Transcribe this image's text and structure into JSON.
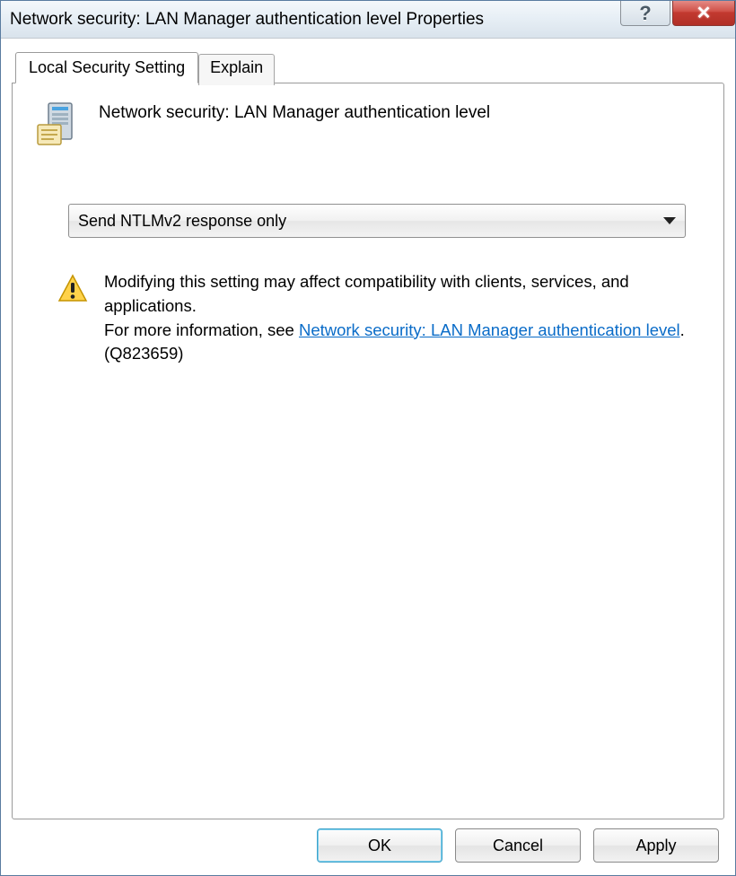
{
  "window": {
    "title": "Network security: LAN Manager authentication level Properties"
  },
  "tabs": {
    "active": "Local Security Setting",
    "inactive": "Explain"
  },
  "policy": {
    "title": "Network security: LAN Manager authentication level"
  },
  "dropdown": {
    "selected": "Send NTLMv2 response only"
  },
  "warning": {
    "line1": "Modifying this setting may affect compatibility with clients, services, and applications.",
    "line2_prefix": "For more information, see ",
    "link_text": "Network security: LAN Manager authentication level",
    "line2_suffix": ". (Q823659)"
  },
  "buttons": {
    "ok": "OK",
    "cancel": "Cancel",
    "apply": "Apply"
  }
}
